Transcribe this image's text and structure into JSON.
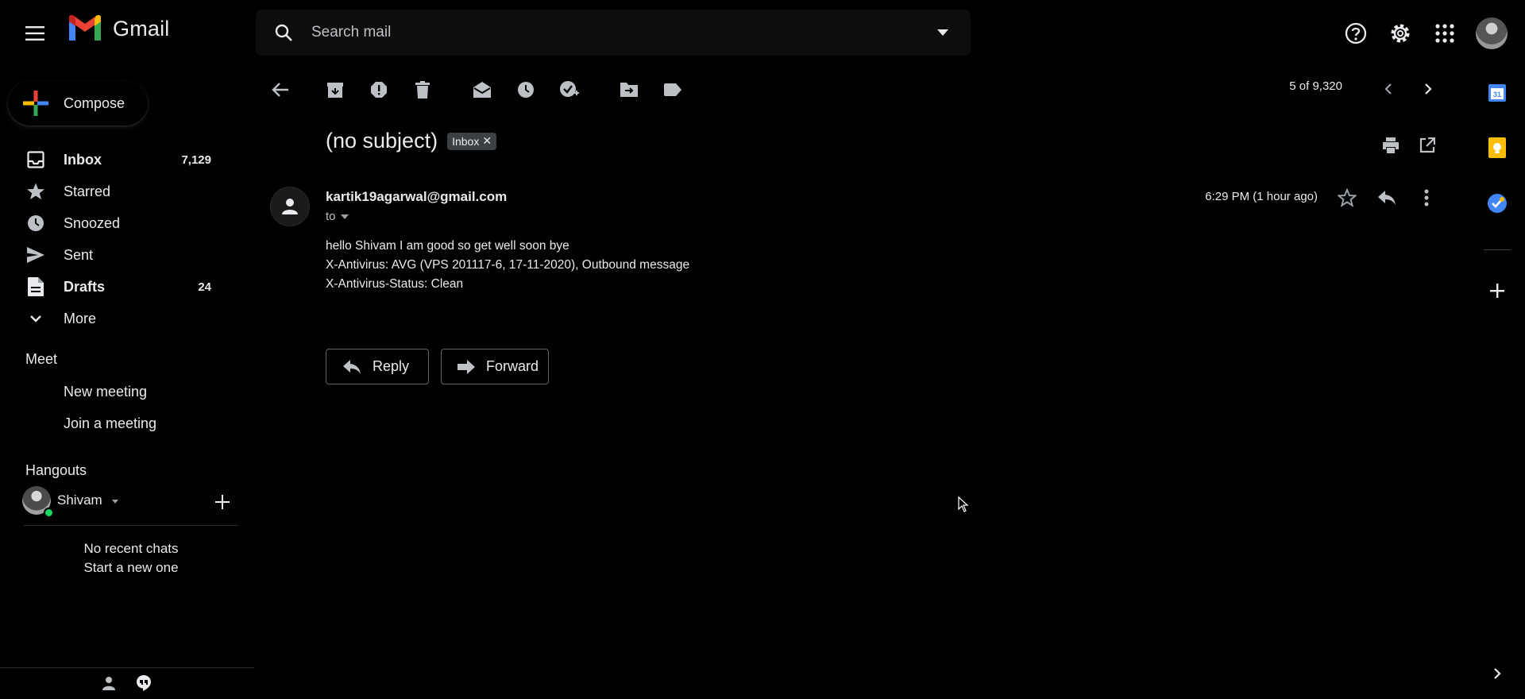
{
  "header": {
    "app_name": "Gmail",
    "search_placeholder": "Search mail"
  },
  "compose": {
    "label": "Compose"
  },
  "nav": {
    "items": [
      {
        "label": "Inbox",
        "count": "7,129",
        "icon": "inbox-icon",
        "bold": true
      },
      {
        "label": "Starred",
        "count": "",
        "icon": "star-icon",
        "bold": false
      },
      {
        "label": "Snoozed",
        "count": "",
        "icon": "clock-icon",
        "bold": false
      },
      {
        "label": "Sent",
        "count": "",
        "icon": "send-icon",
        "bold": false
      },
      {
        "label": "Drafts",
        "count": "24",
        "icon": "draft-icon",
        "bold": true
      },
      {
        "label": "More",
        "count": "",
        "icon": "chevron-down-icon",
        "bold": false
      }
    ]
  },
  "meet": {
    "title": "Meet",
    "new_meeting": "New meeting",
    "join_meeting": "Join a meeting"
  },
  "hangouts": {
    "title": "Hangouts",
    "user": "Shivam",
    "no_chats": "No recent chats",
    "start_new": "Start a new one"
  },
  "toolbar": {
    "pager": "5 of 9,320"
  },
  "message": {
    "subject": "(no subject)",
    "label": "Inbox",
    "sender": "kartik19agarwal@gmail.com",
    "to": "to",
    "time": "6:29 PM (1 hour ago)",
    "body": [
      "hello Shivam I am good so get well soon bye",
      "X-Antivirus: AVG (VPS 201117-6, 17-11-2020), Outbound message",
      "X-Antivirus-Status: Clean"
    ],
    "reply_label": "Reply",
    "forward_label": "Forward"
  },
  "colors": {
    "background": "#000000",
    "text": "#e8eaed",
    "muted": "#bdc1c6",
    "status_online": "#1ed760"
  }
}
